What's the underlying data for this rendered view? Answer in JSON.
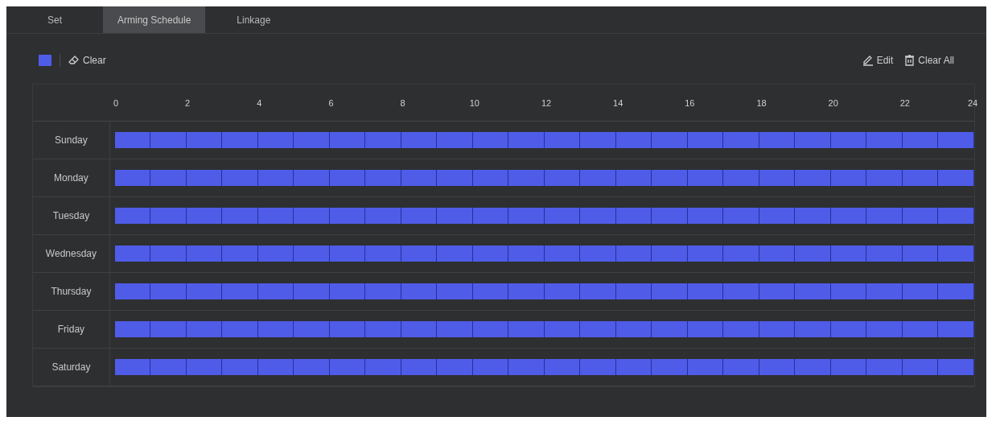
{
  "tabs": [
    {
      "label": "Set",
      "selected": false
    },
    {
      "label": "Arming Schedule",
      "selected": true
    },
    {
      "label": "Linkage",
      "selected": false
    }
  ],
  "toolbar": {
    "swatch": {
      "color": "#4f5ce8"
    },
    "clear": "Clear",
    "edit": "Edit",
    "clear_all": "Clear All"
  },
  "schedule": {
    "hours": [
      "0",
      "2",
      "4",
      "6",
      "8",
      "10",
      "12",
      "14",
      "16",
      "18",
      "20",
      "22",
      "24"
    ],
    "days": [
      {
        "label": "Sunday",
        "slots": [
          true,
          true,
          true,
          true,
          true,
          true,
          true,
          true,
          true,
          true,
          true,
          true,
          true,
          true,
          true,
          true,
          true,
          true,
          true,
          true,
          true,
          true,
          true,
          true
        ]
      },
      {
        "label": "Monday",
        "slots": [
          true,
          true,
          true,
          true,
          true,
          true,
          true,
          true,
          true,
          true,
          true,
          true,
          true,
          true,
          true,
          true,
          true,
          true,
          true,
          true,
          true,
          true,
          true,
          true
        ]
      },
      {
        "label": "Tuesday",
        "slots": [
          true,
          true,
          true,
          true,
          true,
          true,
          true,
          true,
          true,
          true,
          true,
          true,
          true,
          true,
          true,
          true,
          true,
          true,
          true,
          true,
          true,
          true,
          true,
          true
        ]
      },
      {
        "label": "Wednesday",
        "slots": [
          true,
          true,
          true,
          true,
          true,
          true,
          true,
          true,
          true,
          true,
          true,
          true,
          true,
          true,
          true,
          true,
          true,
          true,
          true,
          true,
          true,
          true,
          true,
          true
        ]
      },
      {
        "label": "Thursday",
        "slots": [
          true,
          true,
          true,
          true,
          true,
          true,
          true,
          true,
          true,
          true,
          true,
          true,
          true,
          true,
          true,
          true,
          true,
          true,
          true,
          true,
          true,
          true,
          true,
          true
        ]
      },
      {
        "label": "Friday",
        "slots": [
          true,
          true,
          true,
          true,
          true,
          true,
          true,
          true,
          true,
          true,
          true,
          true,
          true,
          true,
          true,
          true,
          true,
          true,
          true,
          true,
          true,
          true,
          true,
          true
        ]
      },
      {
        "label": "Saturday",
        "slots": [
          true,
          true,
          true,
          true,
          true,
          true,
          true,
          true,
          true,
          true,
          true,
          true,
          true,
          true,
          true,
          true,
          true,
          true,
          true,
          true,
          true,
          true,
          true,
          true
        ]
      }
    ]
  }
}
